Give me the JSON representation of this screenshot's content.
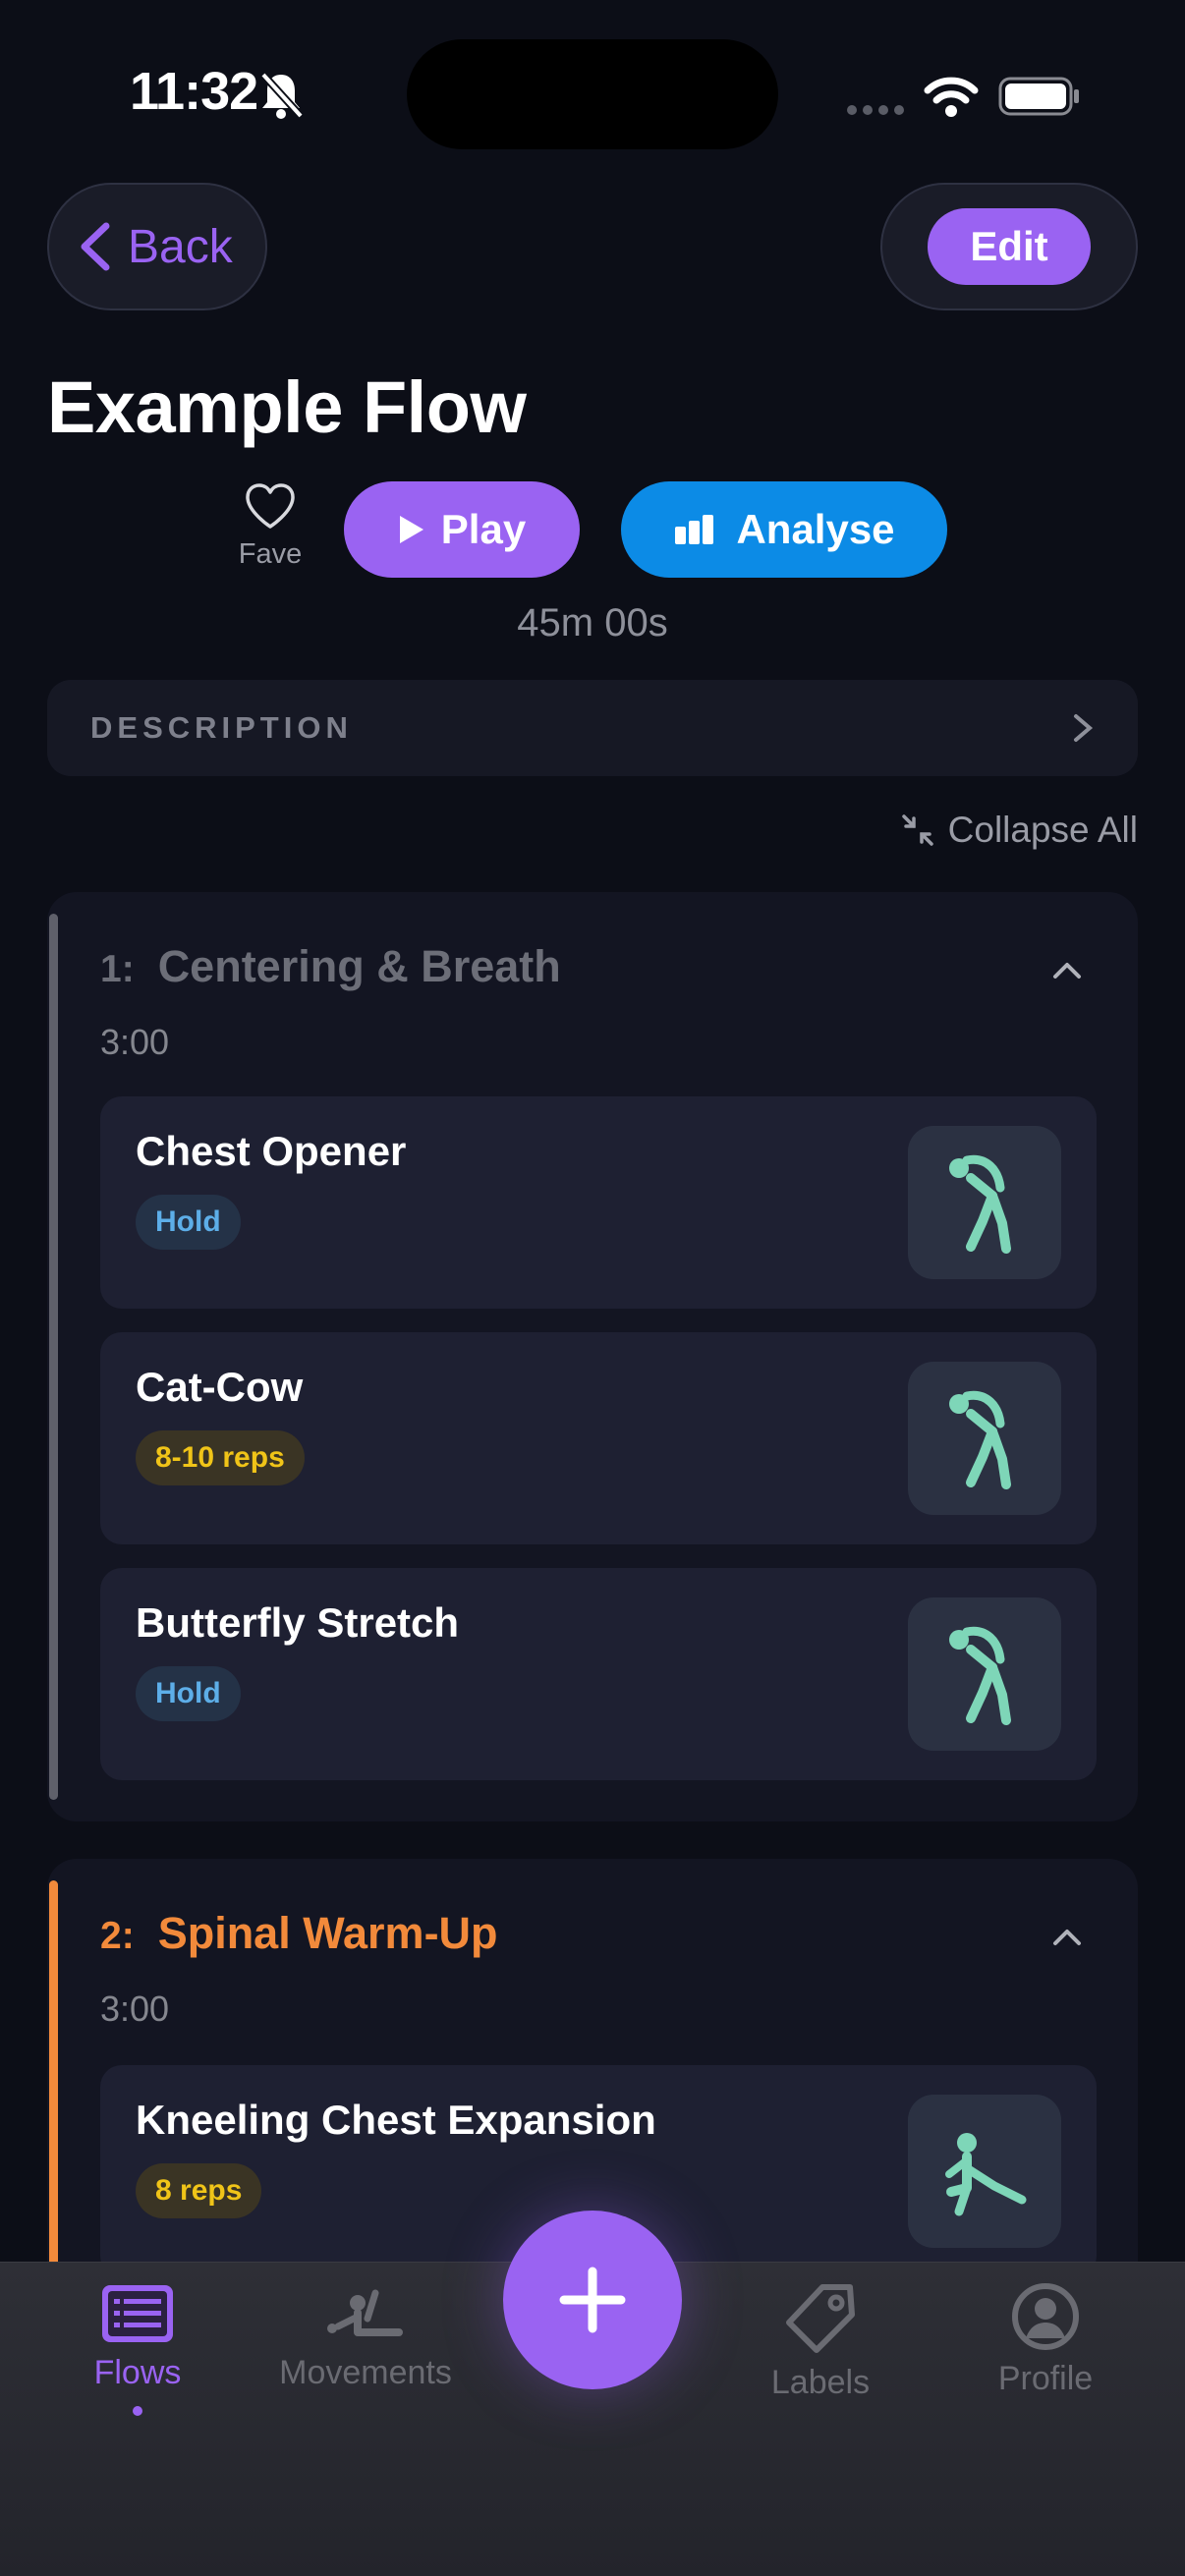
{
  "status_bar": {
    "time": "11:32"
  },
  "header": {
    "back_label": "Back",
    "edit_label": "Edit"
  },
  "flow": {
    "title": "Example Flow",
    "fave_label": "Fave",
    "play_label": "Play",
    "analyse_label": "Analyse",
    "duration": "45m 00s",
    "description_label": "DESCRIPTION",
    "collapse_all_label": "Collapse All"
  },
  "sections": [
    {
      "number": "1:",
      "title": "Centering & Breath",
      "time": "3:00",
      "accent_color": "#5f606a",
      "items": [
        {
          "name": "Chest Opener",
          "tag": "Hold",
          "icon": "standing-stretch-icon"
        },
        {
          "name": "Cat-Cow",
          "tag": "8-10 reps",
          "icon": "standing-stretch-icon"
        },
        {
          "name": "Butterfly Stretch",
          "tag": "Hold",
          "icon": "standing-stretch-icon"
        }
      ]
    },
    {
      "number": "2:",
      "title": "Spinal Warm-Up",
      "time": "3:00",
      "accent_color": "#f28a3b",
      "items": [
        {
          "name": "Kneeling Chest Expansion",
          "tag": "8 reps",
          "icon": "kneeling-stretch-icon"
        }
      ]
    }
  ],
  "tab_bar": {
    "items": [
      {
        "label": "Flows",
        "icon": "flows-list-icon",
        "active": true
      },
      {
        "label": "Movements",
        "icon": "movements-icon",
        "active": false
      },
      {
        "label": "Labels",
        "icon": "tag-icon",
        "active": false
      },
      {
        "label": "Profile",
        "icon": "profile-icon",
        "active": false
      }
    ],
    "fab_icon": "plus-icon"
  },
  "colors": {
    "background": "#0c0e17",
    "accent_purple": "#9a63f2",
    "analyse_blue": "#0c8be6",
    "section_orange": "#f28a3b",
    "hold_tag": "#5daee8",
    "reps_tag": "#f0c418",
    "figure_green": "#7ed6b8"
  }
}
